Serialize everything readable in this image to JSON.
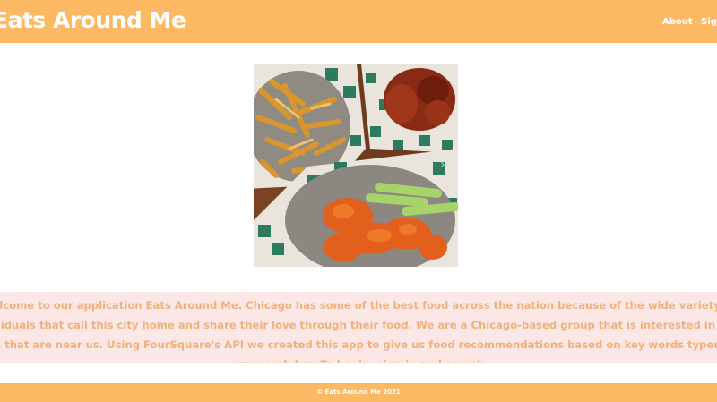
{
  "header": {
    "brand": "Eats Around Me",
    "nav": [
      "About",
      "Sign In"
    ]
  },
  "hero": {
    "image_alt": "wings-and-fries-photo"
  },
  "intro": {
    "text": "Welcome to our application Eats Around Me. Chicago has some of the best food across the nation because of the wide variety of individuals that call this city home and share their love through their food. We are a Chicago-based group that is interested in food spots that are near us. Using FourSquare's API we created this app to give us food recommendations based on key words typed into our search bar. To begin, sign in and search."
  },
  "footer": {
    "copyright": "© Eats Around Me 2021"
  },
  "colors": {
    "header_bg": "#fdb863",
    "intro_bg": "#fbe8e6",
    "intro_text": "#f2b079"
  }
}
